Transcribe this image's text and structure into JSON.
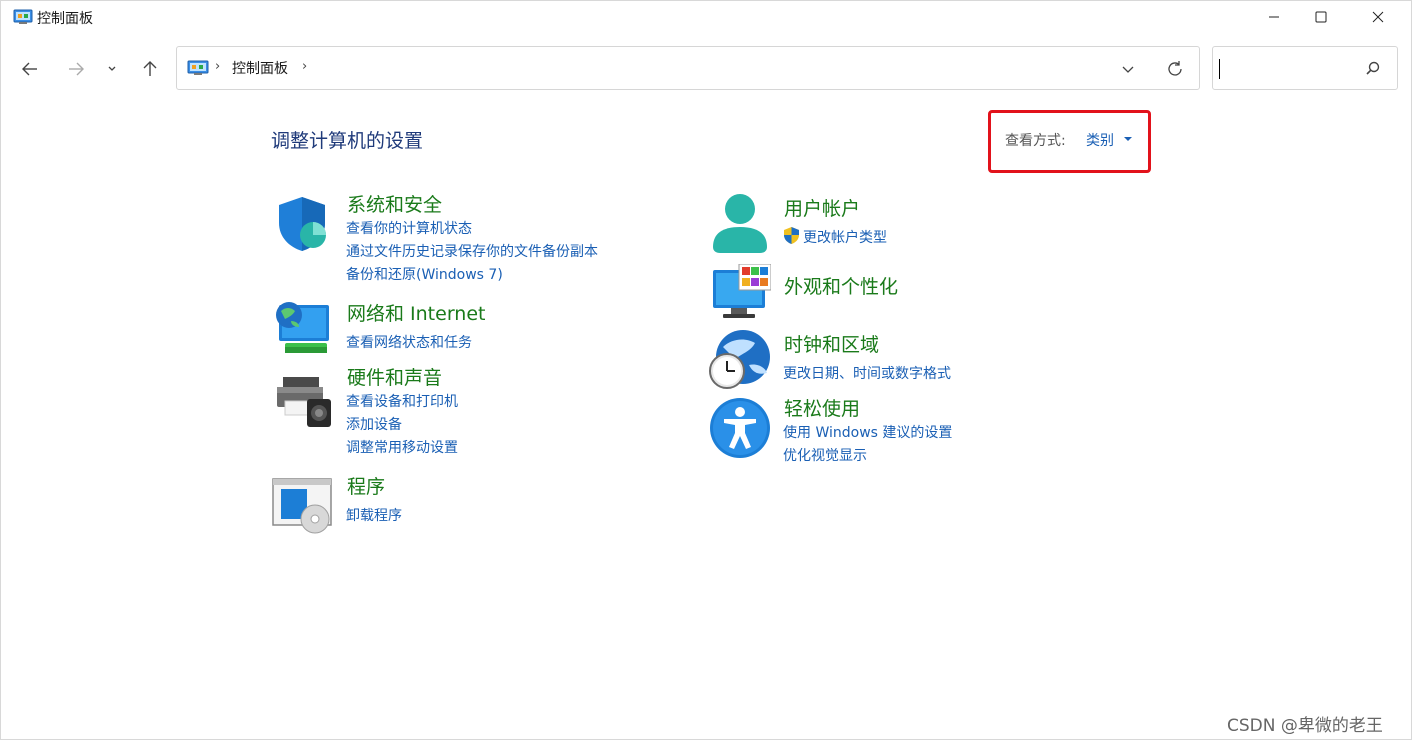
{
  "window": {
    "title": "控制面板",
    "icon": "control-panel-icon"
  },
  "navigation": {
    "address_path": "控制面板",
    "search_placeholder": ""
  },
  "content": {
    "heading": "调整计算机的设置",
    "view_by": {
      "label": "查看方式:",
      "value": "类别"
    },
    "categories": [
      {
        "title": "系统和安全",
        "icon": "shield-icon",
        "links": [
          "查看你的计算机状态",
          "通过文件历史记录保存你的文件备份副本",
          "备份和还原(Windows 7)"
        ]
      },
      {
        "title": "网络和 Internet",
        "icon": "network-globe-icon",
        "links": [
          "查看网络状态和任务"
        ]
      },
      {
        "title": "硬件和声音",
        "icon": "printer-speaker-icon",
        "links": [
          "查看设备和打印机",
          "添加设备",
          "调整常用移动设置"
        ]
      },
      {
        "title": "程序",
        "icon": "programs-disc-icon",
        "links": [
          "卸载程序"
        ]
      },
      {
        "title": "用户帐户",
        "icon": "user-account-icon",
        "links": [
          "更改帐户类型"
        ]
      },
      {
        "title": "外观和个性化",
        "icon": "monitor-colors-icon",
        "links": []
      },
      {
        "title": "时钟和区域",
        "icon": "globe-clock-icon",
        "links": [
          "更改日期、时间或数字格式"
        ]
      },
      {
        "title": "轻松使用",
        "icon": "accessibility-icon",
        "links": [
          "使用 Windows 建议的设置",
          "优化视觉显示"
        ]
      }
    ]
  },
  "watermark": "CSDN @卑微的老王"
}
